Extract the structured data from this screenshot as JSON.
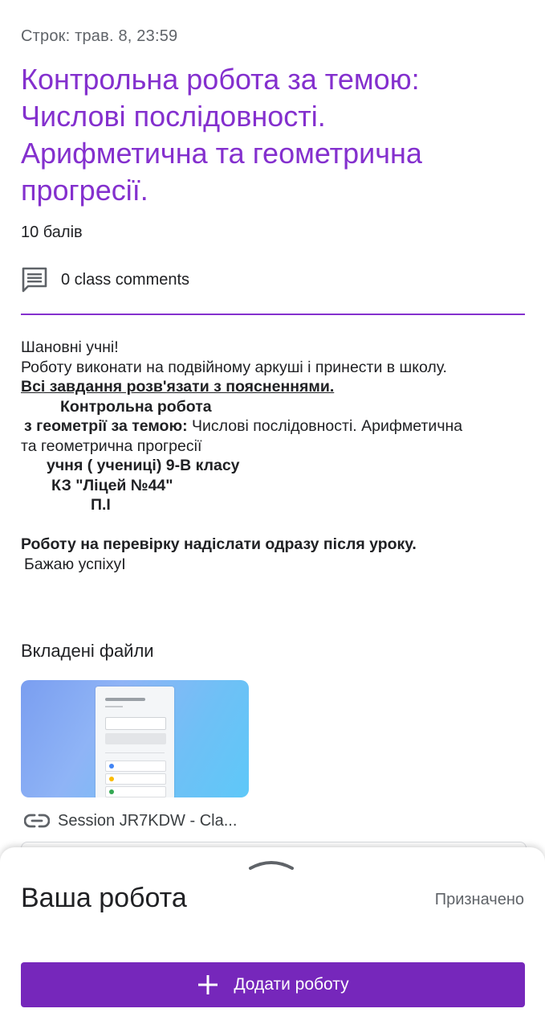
{
  "assignment": {
    "due": "Строк: трав. 8, 23:59",
    "title_lines": [
      "Контрольна робота за темою:",
      "Числові послідовності.",
      "Арифметична та геометрична",
      "прогресії."
    ],
    "points": "10 балів",
    "comments": "0 class comments"
  },
  "description": {
    "line1": "Шановні учні!",
    "line2": "Роботу виконати на подвійному аркуші і принести в школу.",
    "line3": "Всі завдання розв'язати з поясненнями. ",
    "line4": "Контрольна робота",
    "line5_bold": "з геометрії за темою:",
    "line5_rest": " Числові послідовності. Арифметична",
    "line6": "та геометрична прогресії",
    "line7": "учня ( учениці) 9-В класу",
    "line8": "КЗ \"Ліцей №44\"",
    "line9": "П.І",
    "line10": "Роботу на перевірку надіслати одразу після уроку.",
    "line11": "Бажаю успіхуI"
  },
  "attachments": {
    "title": "Вкладені файли",
    "link_label": "Session JR7KDW - Cla..."
  },
  "work_sheet": {
    "title": "Ваша робота",
    "status": "Призначено",
    "add_button": "Додати роботу"
  },
  "colors": {
    "accent": "#8430ce",
    "button": "#7627bb"
  }
}
